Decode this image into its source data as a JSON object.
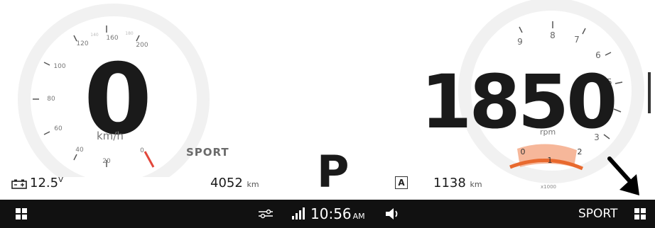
{
  "speedometer": {
    "speed": "0",
    "unit": "km/h",
    "ticks": [
      "20",
      "40",
      "60",
      "80",
      "100",
      "120",
      "140",
      "160",
      "180",
      "200",
      "0"
    ]
  },
  "tachometer": {
    "rpm": "1850",
    "unit": "rpm",
    "ticks": [
      "3",
      "4",
      "5",
      "6",
      "7",
      "8",
      "9"
    ],
    "sub_ticks": [
      "0",
      "1",
      "2"
    ],
    "sub_scale": "x1000",
    "shift_zone_color": "#f6b79a",
    "needle_color": "#e8692e"
  },
  "drive_mode": "SPORT",
  "gear": "P",
  "battery": {
    "value": "12.5",
    "unit": "V"
  },
  "odometer": {
    "value": "4052",
    "unit": "km"
  },
  "trip": {
    "label": "A",
    "value": "1138",
    "unit": "km"
  },
  "taskbar": {
    "time": "10:56",
    "ampm": "AM",
    "mode": "SPORT"
  }
}
